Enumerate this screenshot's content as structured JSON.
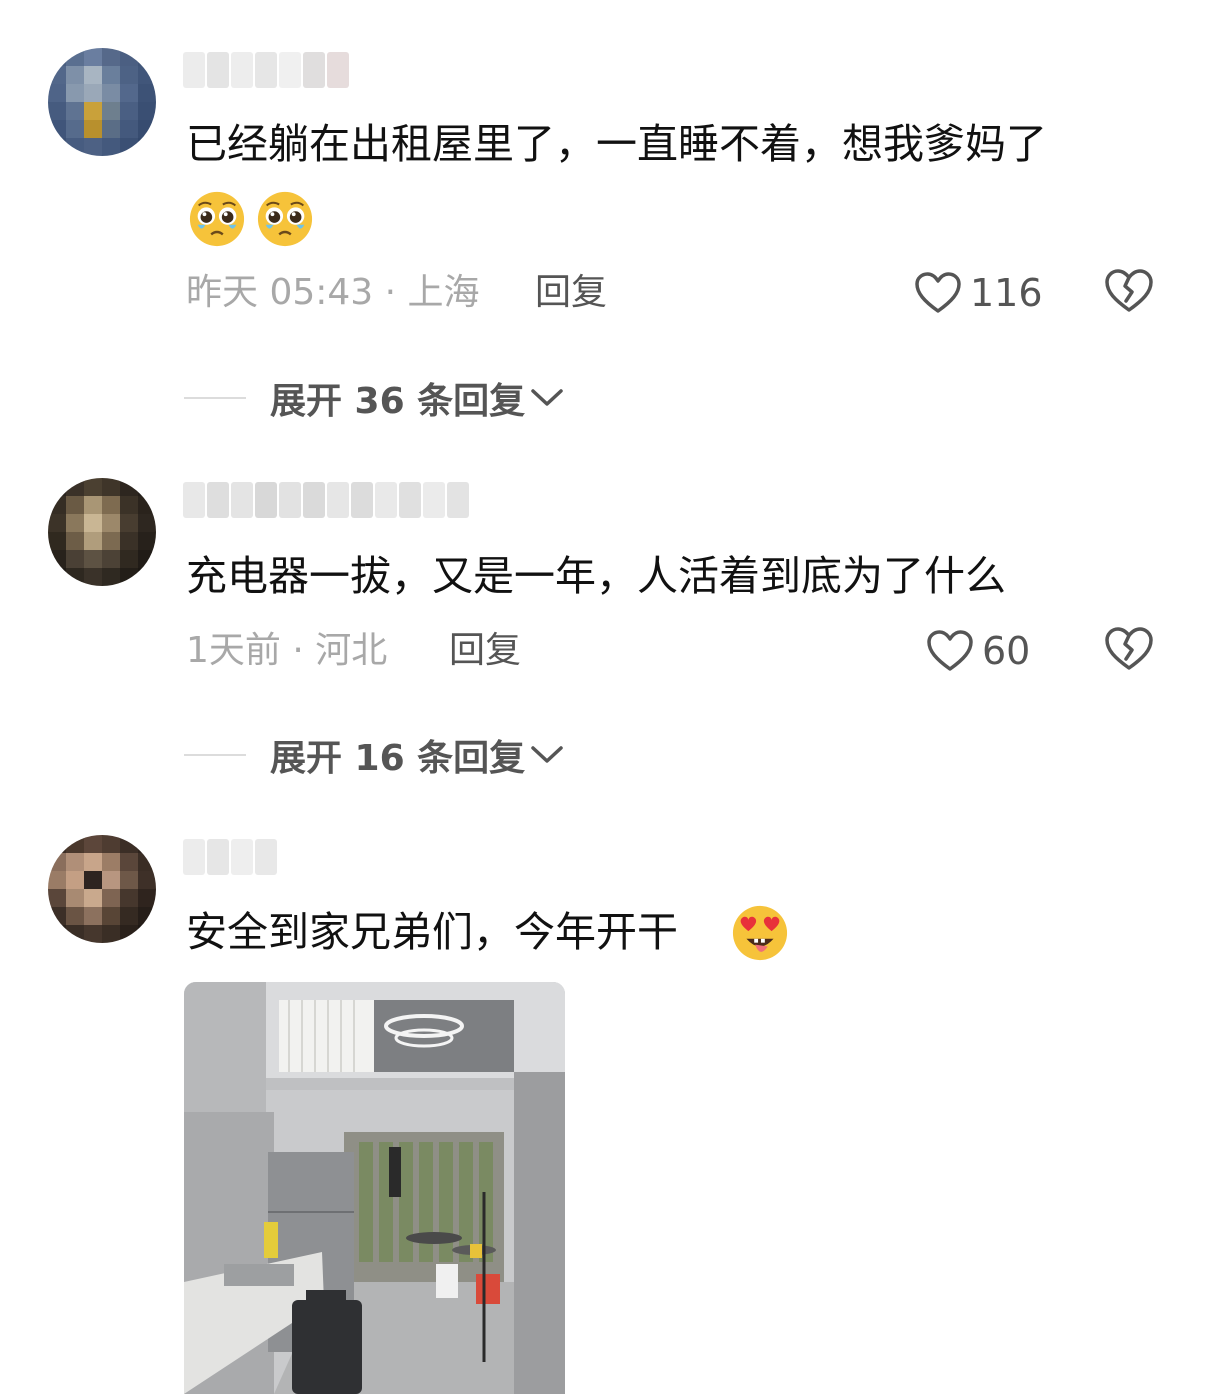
{
  "comments": [
    {
      "text": "已经躺在出租屋里了，一直睡不着，想我爹妈了",
      "emojis": [
        "pleading-face",
        "pleading-face"
      ],
      "time_location": "昨天 05:43 · 上海",
      "reply_label": "回复",
      "like_count": "116",
      "expand_label": "展开 36 条回复"
    },
    {
      "text": "充电器一拔，又是一年，人活着到底为了什么",
      "time_location": "1天前 · 河北",
      "reply_label": "回复",
      "like_count": "60",
      "expand_label": "展开 16 条回复"
    },
    {
      "text": "安全到家兄弟们，今年开干",
      "emojis": [
        "heart-eyes-tongue-face"
      ],
      "has_photo": true
    }
  ],
  "icons": {
    "like": "heart-outline-icon",
    "dislike": "broken-heart-icon",
    "expand": "chevron-down-icon"
  },
  "colors": {
    "text": "#111111",
    "meta": "#a8a8a8",
    "action": "#555555",
    "emoji_face": "#f6c33a"
  }
}
